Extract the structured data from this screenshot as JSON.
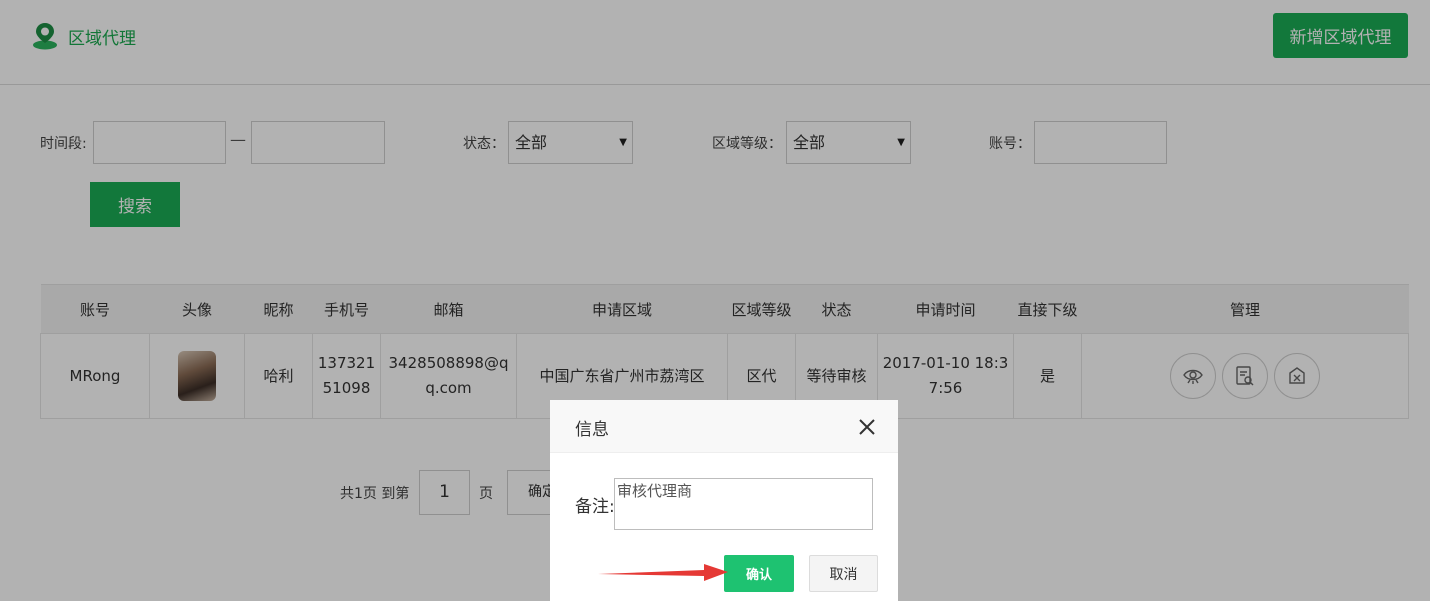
{
  "header": {
    "title": "区域代理",
    "new_button": "新增区域代理",
    "brand_color": "#1aa94f"
  },
  "filters": {
    "time_label": "时间段:",
    "time_separator": "—",
    "status_label": "状态：",
    "status_value": "全部",
    "level_label": "区域等级：",
    "level_value": "全部",
    "account_label": "账号：",
    "search_button": "搜索"
  },
  "table": {
    "columns": [
      "账号",
      "头像",
      "昵称",
      "手机号",
      "邮箱",
      "申请区域",
      "区域等级",
      "状态",
      "申请时间",
      "直接下级",
      "管理"
    ],
    "rows": [
      {
        "account": "MRong",
        "nickname": "哈利",
        "phone": "13732151098",
        "email": "3428508898@qq.com",
        "region": "中国广东省广州市荔湾区",
        "level": "区代",
        "status": "等待审核",
        "apply_time": "2017-01-10 18:37:56",
        "direct_sub": "是",
        "actions": [
          "view-icon",
          "review-icon",
          "revoke-icon"
        ]
      }
    ]
  },
  "pagination": {
    "total_text": "共1页 到第",
    "page_value": "1",
    "page_suffix": "页",
    "confirm_label": "确定"
  },
  "dialog": {
    "title": "信息",
    "remark_label": "备注:",
    "remark_value": "审核代理商",
    "ok_button": "确认",
    "cancel_button": "取消"
  },
  "colors": {
    "accent": "#1aad55",
    "ok": "#1ec271",
    "annotation_arrow": "#e53935"
  }
}
